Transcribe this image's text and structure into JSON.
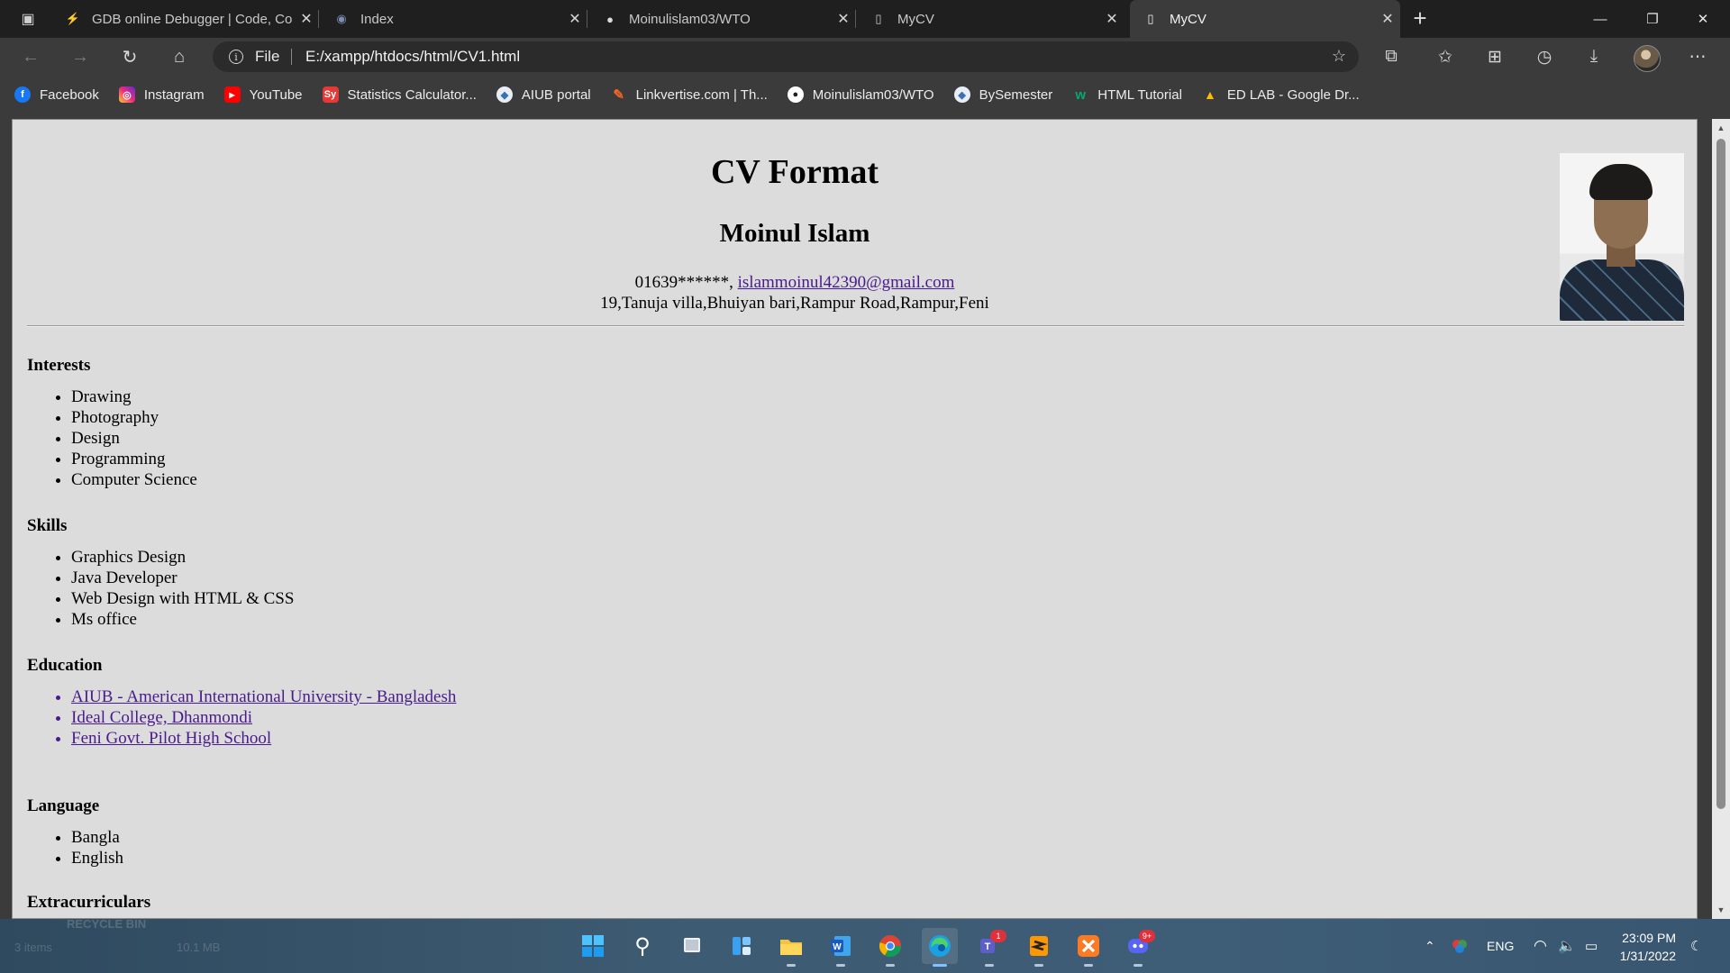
{
  "browser": {
    "tabs": [
      {
        "title": "GDB online Debugger | Code, Co",
        "icon": "gdb-icon"
      },
      {
        "title": "Index",
        "icon": "globe-icon"
      },
      {
        "title": "Moinulislam03/WTO",
        "icon": "github-icon"
      },
      {
        "title": "MyCV",
        "icon": "file-icon"
      },
      {
        "title": "MyCV",
        "icon": "file-icon",
        "active": true
      }
    ],
    "address": {
      "protocol": "File",
      "url": "E:/xampp/htdocs/html/CV1.html"
    },
    "bookmarks": [
      {
        "label": "Facebook",
        "color": "#1877f2",
        "glyph": "f"
      },
      {
        "label": "Instagram",
        "color": "#d62976",
        "glyph": "◎"
      },
      {
        "label": "YouTube",
        "color": "#ff0000",
        "glyph": "▶"
      },
      {
        "label": "Statistics Calculator...",
        "color": "#e53935",
        "glyph": "Sy"
      },
      {
        "label": "AIUB portal",
        "color": "#3b6fb6",
        "glyph": "◆"
      },
      {
        "label": "Linkvertise.com | Th...",
        "color": "#f26522",
        "glyph": "✎"
      },
      {
        "label": "Moinulislam03/WTO",
        "color": "#ffffff",
        "glyph": "●"
      },
      {
        "label": "BySemester",
        "color": "#3b6fb6",
        "glyph": "◆"
      },
      {
        "label": "HTML Tutorial",
        "color": "#04aa6d",
        "glyph": "w"
      },
      {
        "label": "ED LAB - Google Dr...",
        "color": "#fbbc04",
        "glyph": "▲"
      }
    ]
  },
  "cv": {
    "title": "CV Format",
    "name": "Moinul Islam",
    "phone": "01639******,",
    "email": "islammoinul42390@gmail.com",
    "address": "19,Tanuja villa,Bhuiyan bari,Rampur Road,Rampur,Feni",
    "sections": {
      "interests": {
        "heading": "Interests",
        "items": [
          "Drawing",
          "Photography",
          "Design",
          "Programming",
          "Computer Science"
        ]
      },
      "skills": {
        "heading": "Skills",
        "items": [
          "Graphics Design",
          "Java Developer",
          "Web Design with HTML & CSS",
          "Ms office"
        ]
      },
      "education": {
        "heading": "Education",
        "items": [
          "AIUB - American International University - Bangladesh",
          "Ideal College, Dhanmondi",
          "Feni Govt. Pilot High School"
        ]
      },
      "language": {
        "heading": "Language",
        "items": [
          "Bangla",
          "English"
        ]
      },
      "extracurriculars": {
        "heading": "Extracurriculars"
      }
    }
  },
  "desktop": {
    "ghost_recycle": "RECYCLE BIN",
    "ghost_items": "3 items",
    "ghost_size": "10.1 MB"
  },
  "taskbar": {
    "badges": {
      "teams": "1",
      "discord": "9+"
    },
    "tray": {
      "lang": "ENG"
    },
    "clock": {
      "time": "23:09 PM",
      "date": "1/31/2022"
    }
  }
}
